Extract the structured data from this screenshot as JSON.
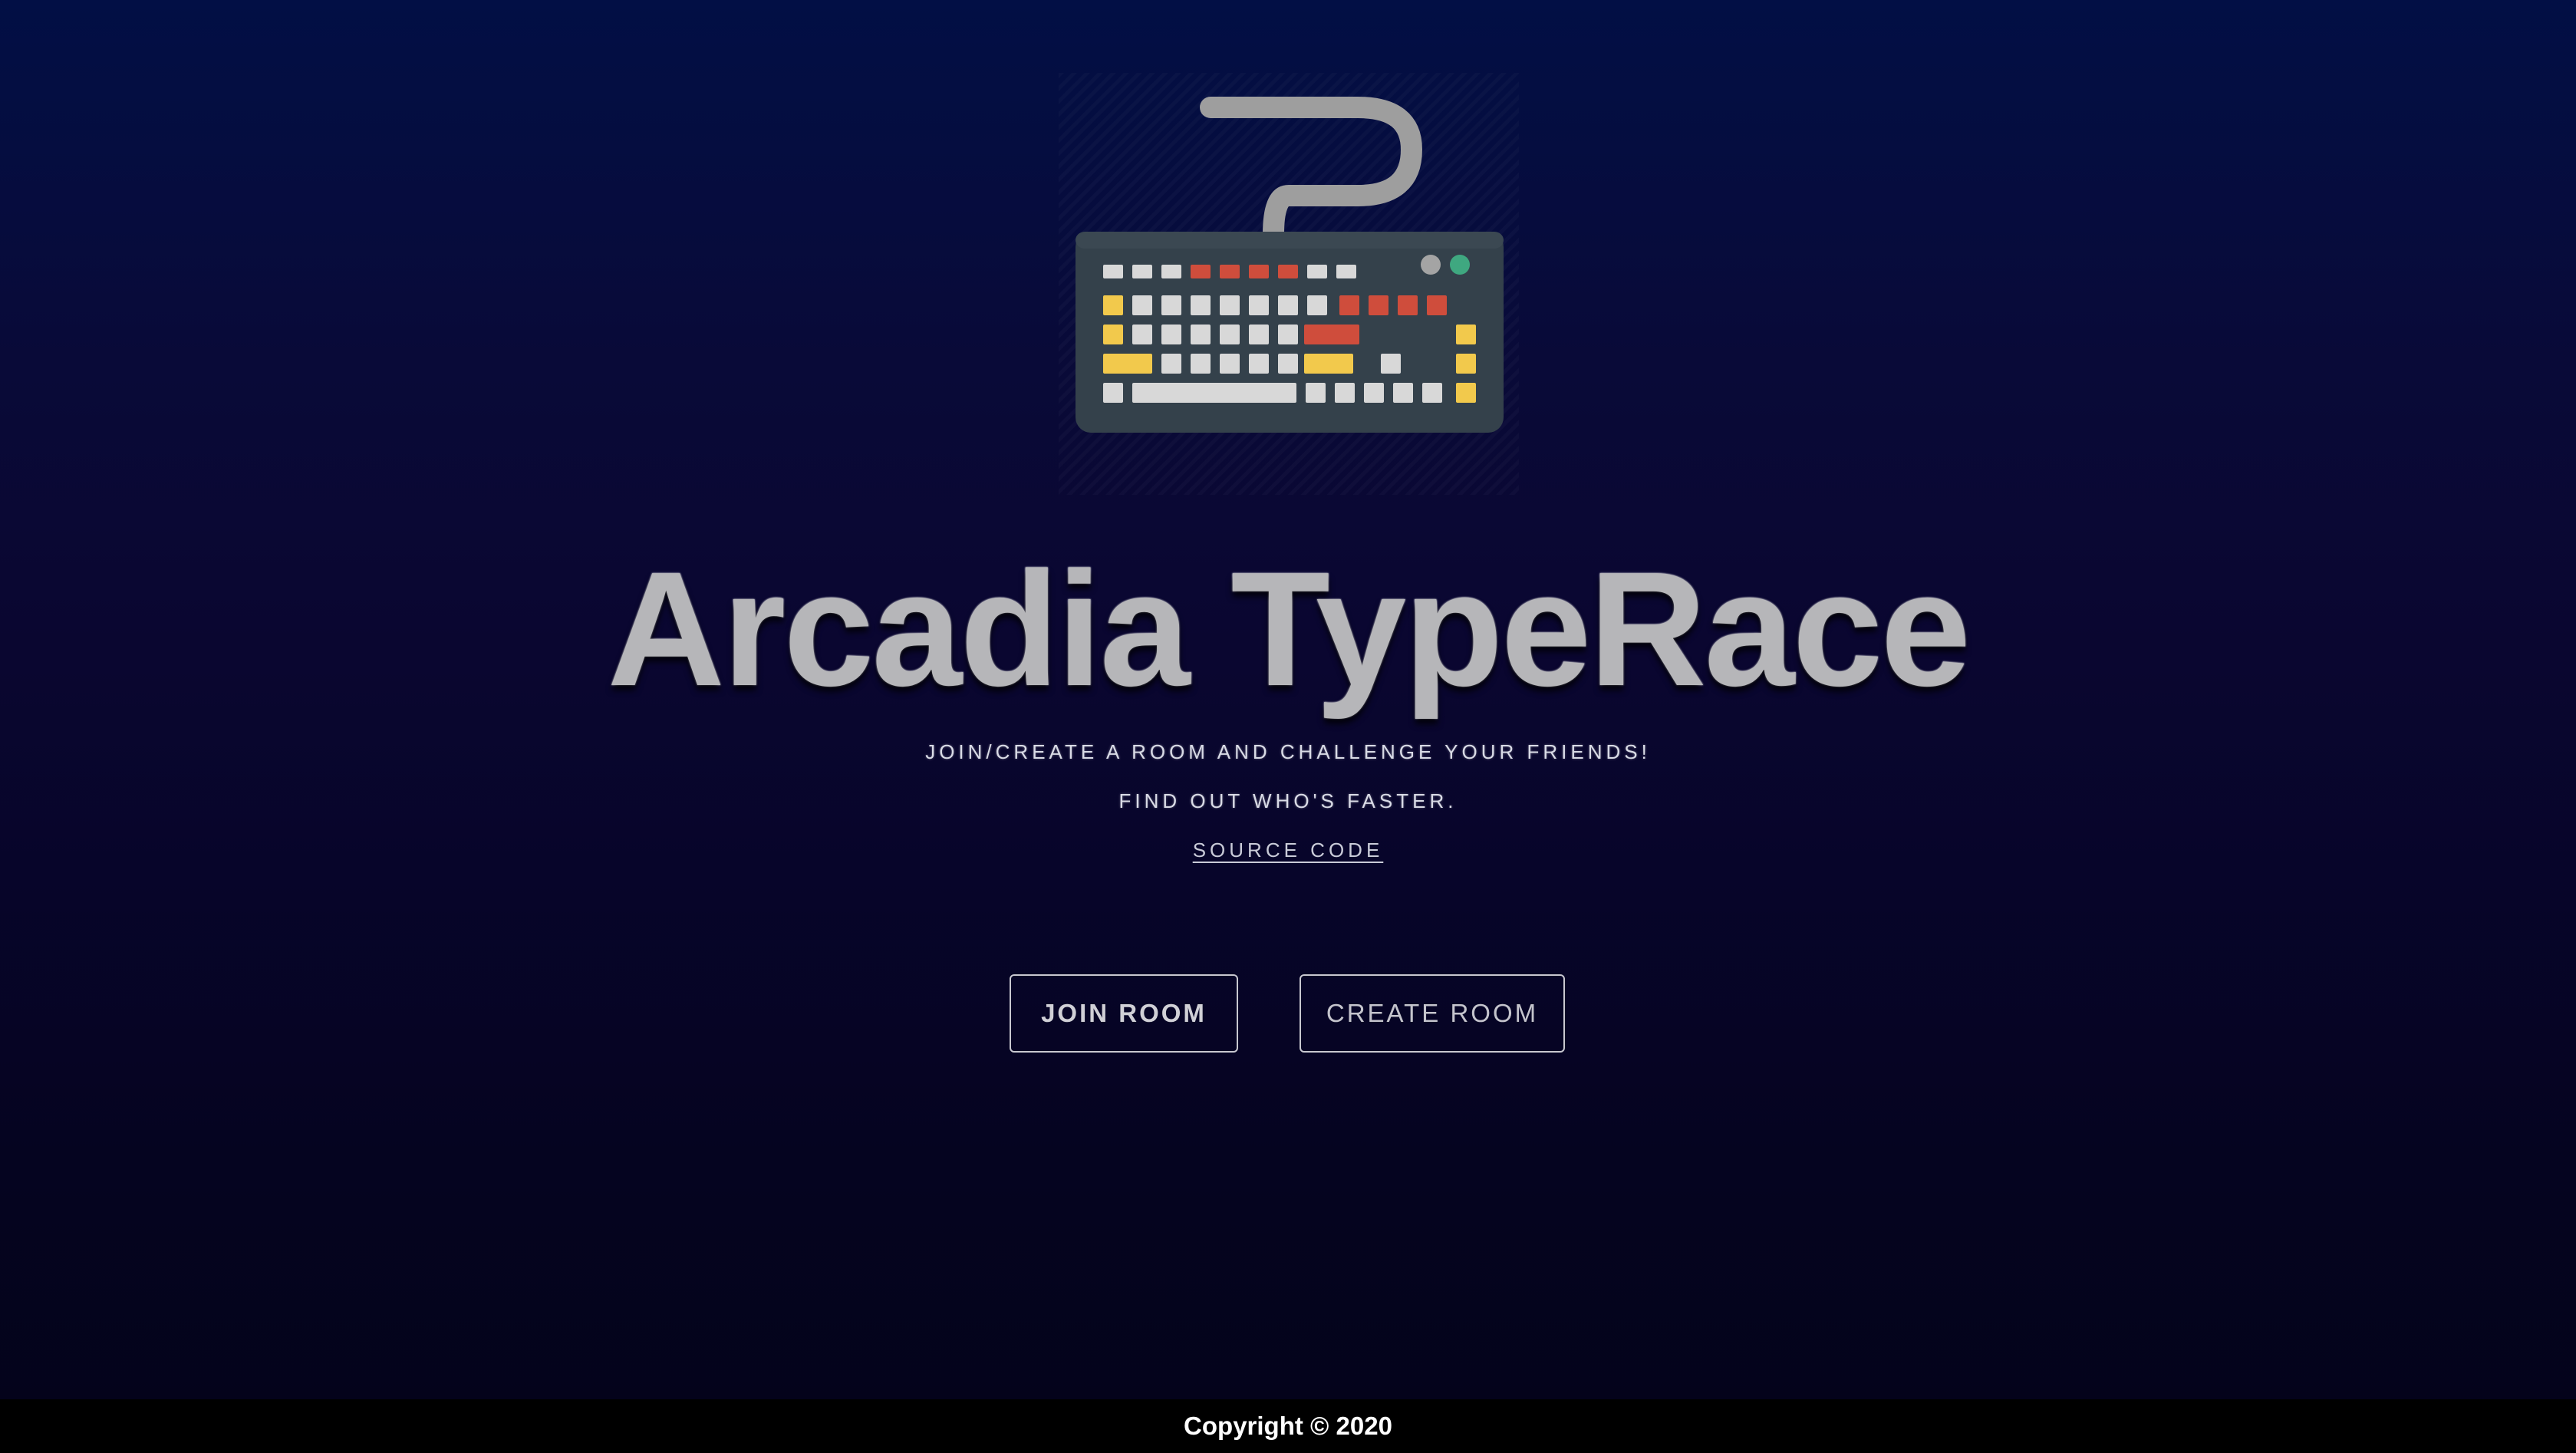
{
  "app": {
    "title": "Arcadia TypeRace",
    "logo_icon": "keyboard-icon"
  },
  "hero": {
    "tagline_line1": "JOIN/CREATE A ROOM AND CHALLENGE YOUR FRIENDS!",
    "tagline_line2": "FIND OUT WHO'S FASTER.",
    "source_link": "SOURCE CODE"
  },
  "actions": {
    "join_label": "JOIN ROOM",
    "create_label": "CREATE ROOM"
  },
  "footer": {
    "copyright": "Copyright © 2020"
  },
  "colors": {
    "background_top": "#020f45",
    "background_bottom": "#04031a",
    "title": "#b6b6b9",
    "keyboard_body": "#34414b",
    "key_grey": "#d8d8d8",
    "key_red": "#cf4d3c",
    "key_yellow": "#f2c94c",
    "led_green": "#3fa880",
    "led_grey": "#a4a4a4",
    "cable": "#9e9e9e",
    "footer": "#000000"
  }
}
